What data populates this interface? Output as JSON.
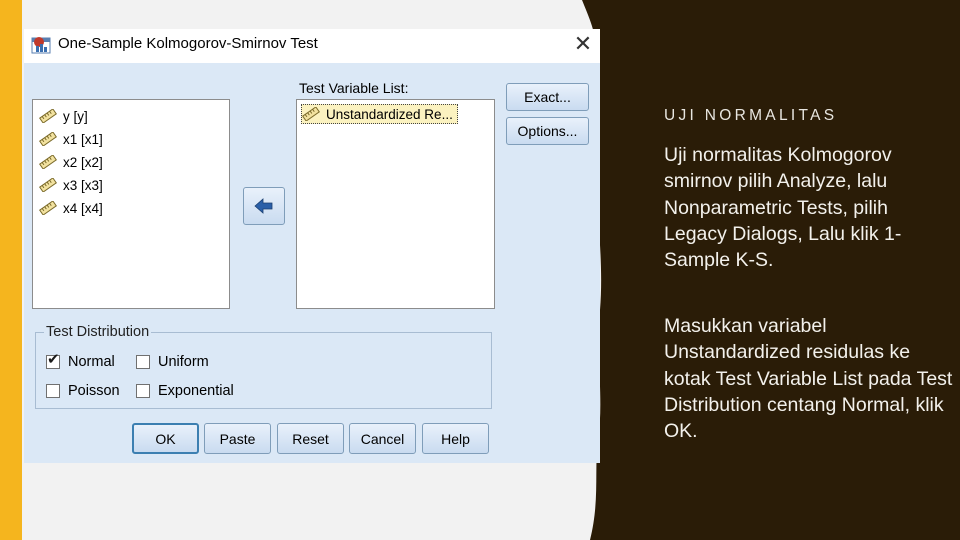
{
  "dialog": {
    "title": "One-Sample Kolmogorov-Smirnov Test",
    "close_symbol": "✕",
    "source_variables": [
      {
        "name": "y",
        "label": "[y]"
      },
      {
        "name": "x1",
        "label": "[x1]"
      },
      {
        "name": "x2",
        "label": "[x2]"
      },
      {
        "name": "x3",
        "label": "[x3]"
      },
      {
        "name": "x4",
        "label": "[x4]"
      }
    ],
    "test_variable_list_label": "Test Variable List:",
    "test_variables": [
      "Unstandardized Re..."
    ],
    "side_buttons": {
      "exact": "Exact...",
      "options": "Options..."
    },
    "test_distribution": {
      "title": "Test Distribution",
      "options": [
        {
          "label": "Normal",
          "checked": true
        },
        {
          "label": "Uniform",
          "checked": false
        },
        {
          "label": "Poisson",
          "checked": false
        },
        {
          "label": "Exponential",
          "checked": false
        }
      ]
    },
    "bottom_buttons": {
      "ok": "OK",
      "paste": "Paste",
      "reset": "Reset",
      "cancel": "Cancel",
      "help": "Help"
    }
  },
  "slide": {
    "heading": "UJI NORMALITAS",
    "paragraph1": "Uji normalitas Kolmogorov smirnov pilih Analyze, lalu Nonparametric Tests, pilih Legacy Dialogs, Lalu klik 1-Sample K-S.",
    "paragraph2": "Masukkan variabel Unstandardized residulas ke kotak Test Variable List pada Test Distribution centang Normal, klik OK."
  },
  "colors": {
    "accent_bar": "#f5b51e",
    "dark_panel": "#2a1c07",
    "dialog_bg": "#dbe8f6"
  },
  "icons": {
    "app": "spss-dialog-icon",
    "variable": "scale-ruler-icon",
    "move": "move-arrow-icon"
  }
}
